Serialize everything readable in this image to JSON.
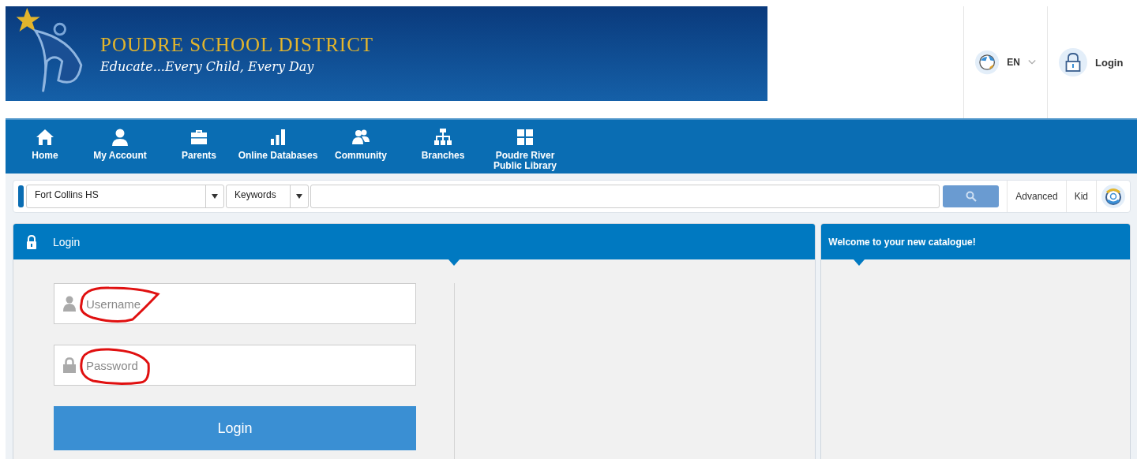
{
  "banner": {
    "title": "POUDRE SCHOOL DISTRICT",
    "tagline": "Educate...Every Child, Every Day"
  },
  "top_actions": {
    "language": "EN",
    "login": "Login"
  },
  "nav": [
    {
      "kind": "home",
      "label": "Home"
    },
    {
      "kind": "account",
      "label": "My Account"
    },
    {
      "kind": "parents",
      "label": "Parents"
    },
    {
      "kind": "databases",
      "label": "Online Databases"
    },
    {
      "kind": "community",
      "label": "Community"
    },
    {
      "kind": "branches",
      "label": "Branches"
    },
    {
      "kind": "library",
      "label": "Poudre River Public Library"
    }
  ],
  "search": {
    "library": "Fort Collins HS",
    "field": "Keywords",
    "links": [
      "Advanced",
      "Kid"
    ]
  },
  "login_panel": {
    "title": "Login",
    "username_placeholder": "Username",
    "password_placeholder": "Password",
    "button": "Login"
  },
  "welcome_panel": {
    "title": "Welcome to your new catalogue!"
  }
}
